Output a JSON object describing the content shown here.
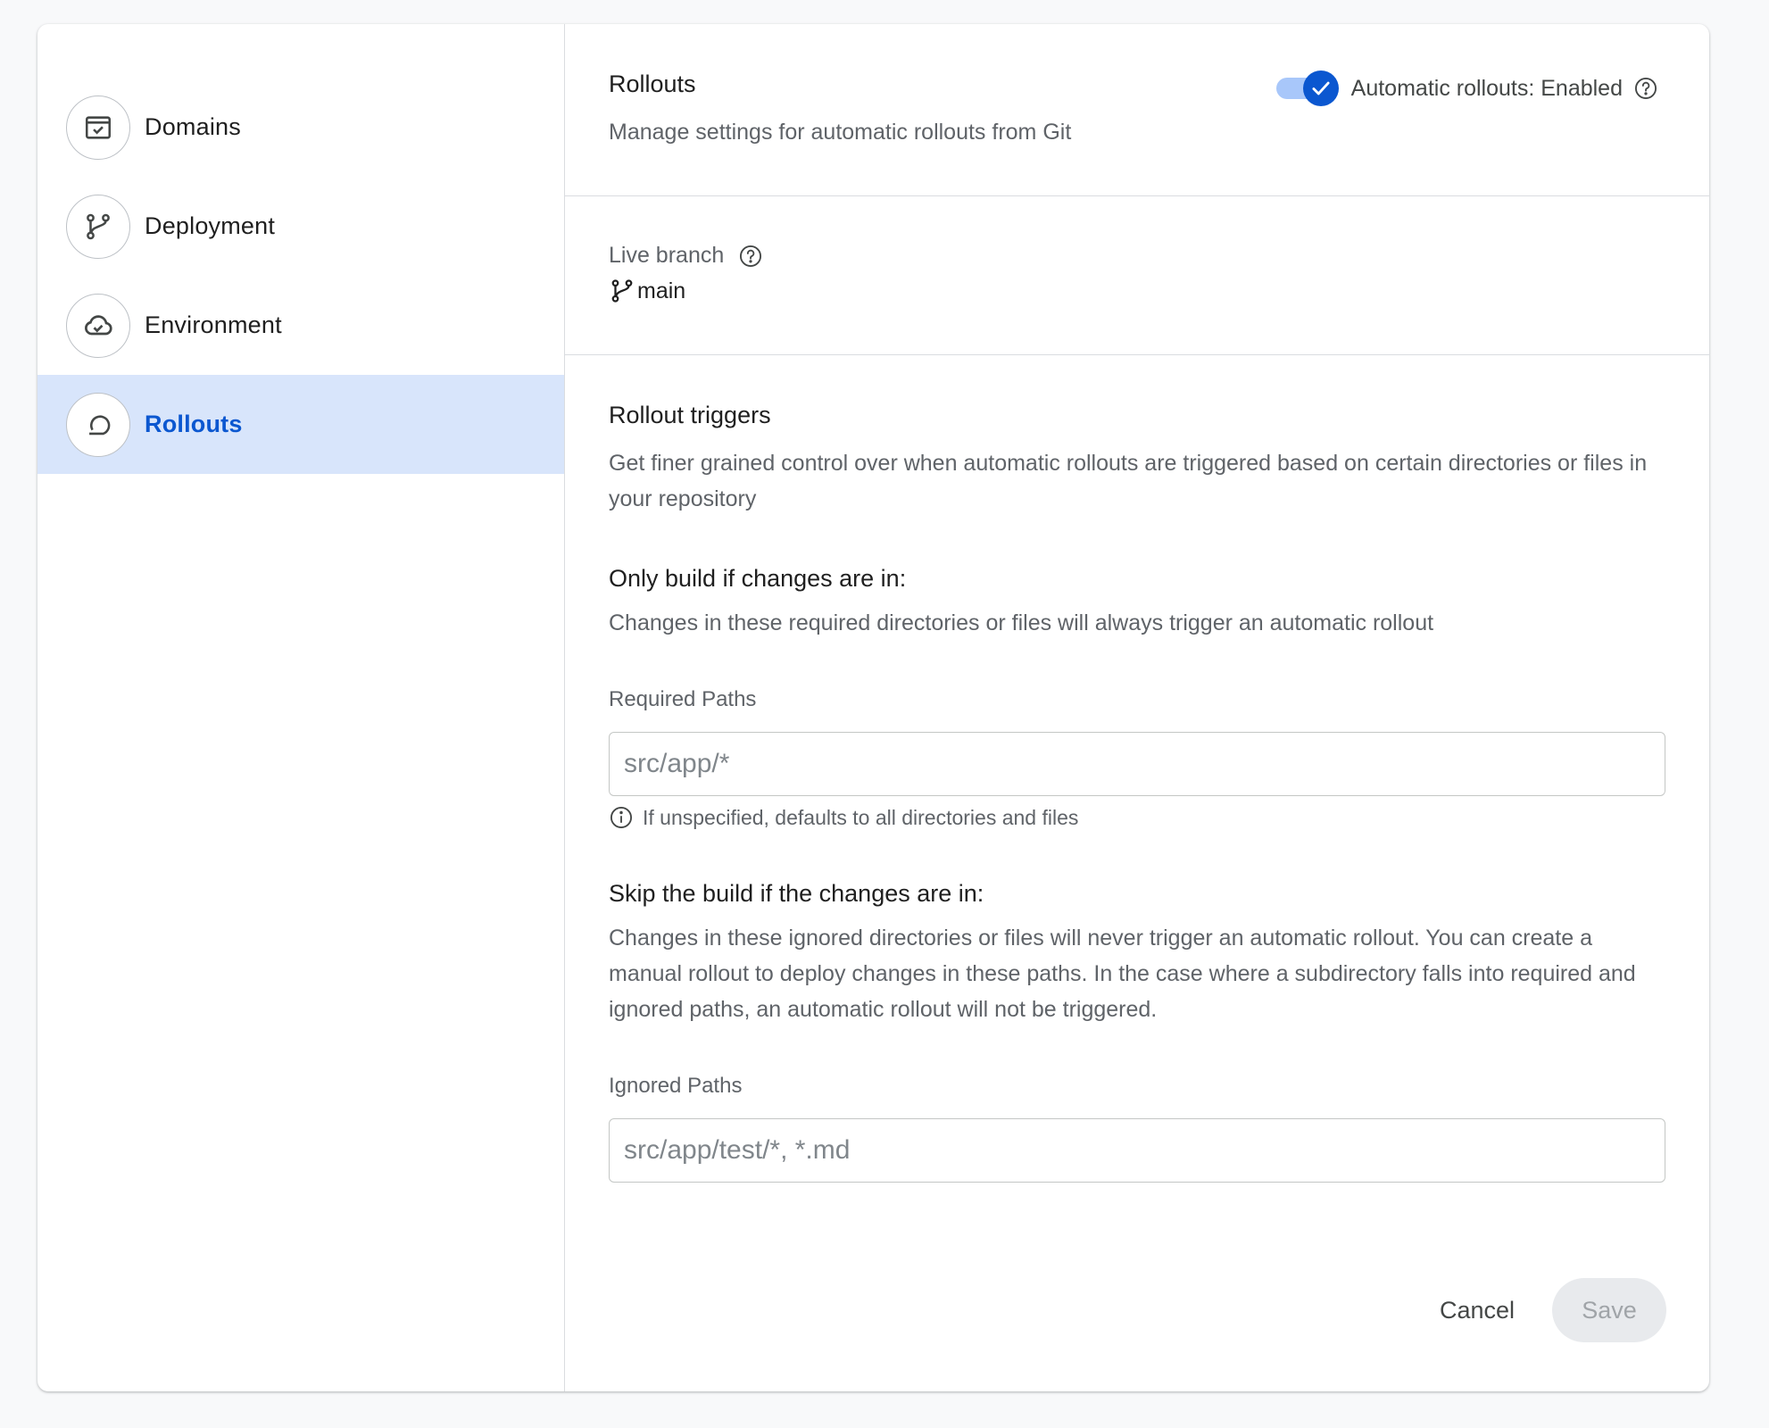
{
  "sidebar": {
    "items": [
      {
        "label": "Domains",
        "icon": "browser-check-icon",
        "active": false
      },
      {
        "label": "Deployment",
        "icon": "git-branch-icon",
        "active": false
      },
      {
        "label": "Environment",
        "icon": "cloud-done-icon",
        "active": false
      },
      {
        "label": "Rollouts",
        "icon": "rollout-icon",
        "active": true
      }
    ]
  },
  "header": {
    "title": "Rollouts",
    "description": "Manage settings for automatic rollouts from Git",
    "toggle_label": "Automatic rollouts: Enabled",
    "toggle_on": true
  },
  "branch": {
    "label": "Live branch",
    "value": "main"
  },
  "triggers": {
    "title": "Rollout triggers",
    "description": "Get finer grained control over when automatic rollouts are triggered based on certain directories or files in your repository",
    "required": {
      "title": "Only build if changes are in:",
      "description": "Changes in these required directories or files will always trigger an automatic rollout",
      "field_label": "Required Paths",
      "placeholder": "src/app/*",
      "value": "",
      "hint": "If unspecified, defaults to all directories and files"
    },
    "ignored": {
      "title": "Skip the build if the changes are in:",
      "description": "Changes in these ignored directories or files will never trigger an automatic rollout. You can create a manual rollout to deploy changes in these paths. In the case where a subdirectory falls into required and ignored paths, an automatic rollout will not be triggered.",
      "field_label": "Ignored Paths",
      "placeholder": "src/app/test/*, *.md",
      "value": ""
    }
  },
  "footer": {
    "cancel_label": "Cancel",
    "save_label": "Save",
    "save_enabled": false
  },
  "colors": {
    "accent": "#0b57d0",
    "active_nav_bg": "#d8e5fb",
    "toggle_track": "#a8c7fa"
  }
}
